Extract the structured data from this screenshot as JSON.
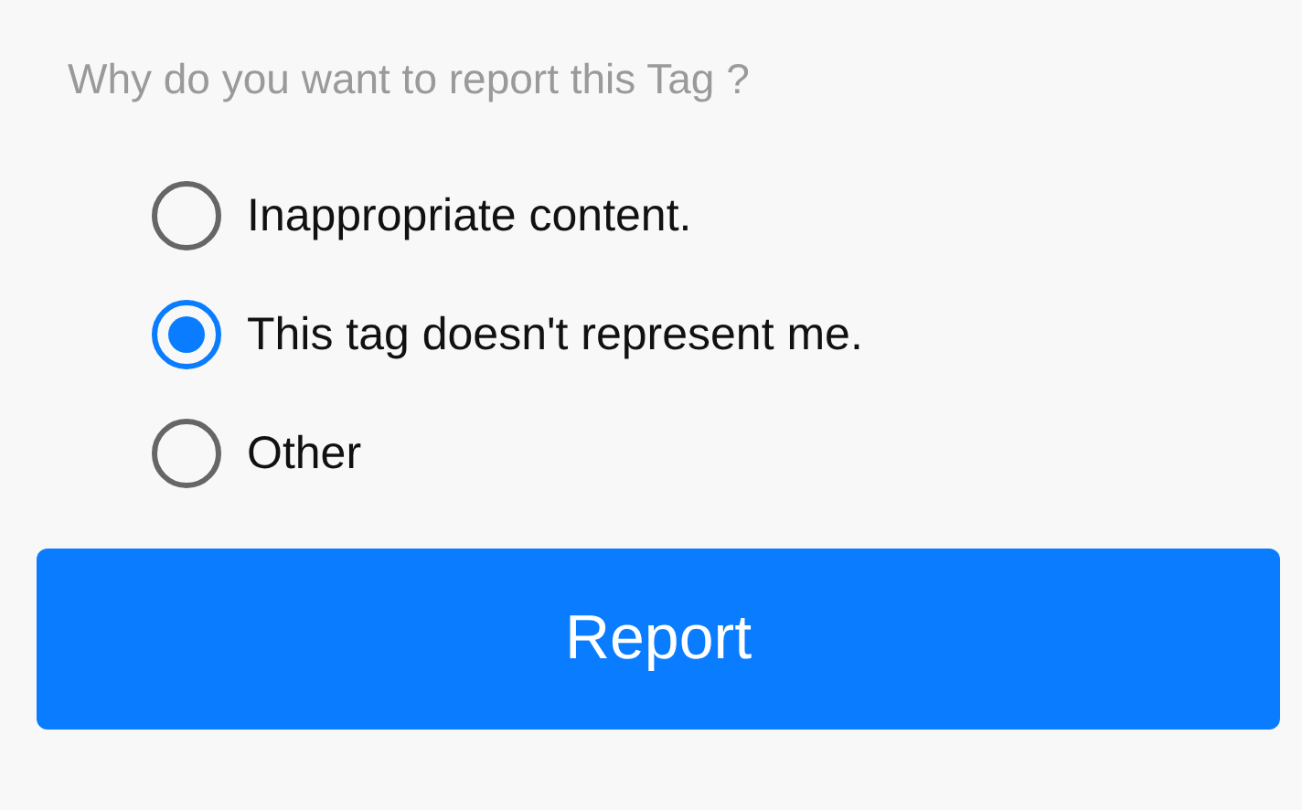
{
  "prompt": "Why do you want to report this Tag ?",
  "options": [
    {
      "label": "Inappropriate content.",
      "selected": false
    },
    {
      "label": "This tag doesn't represent me.",
      "selected": true
    },
    {
      "label": "Other",
      "selected": false
    }
  ],
  "button": "Report"
}
